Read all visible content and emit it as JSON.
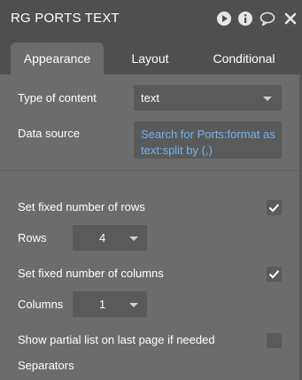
{
  "header": {
    "title": "RG PORTS TEXT",
    "icons": [
      "play-icon",
      "info-icon",
      "comment-icon",
      "close-icon"
    ]
  },
  "tabs": [
    {
      "label": "Appearance",
      "active": true
    },
    {
      "label": "Layout",
      "active": false
    },
    {
      "label": "Conditional",
      "active": false
    }
  ],
  "appearance": {
    "type_of_content": {
      "label": "Type of content",
      "value": "text"
    },
    "data_source": {
      "label": "Data source",
      "value": "Search for Ports:format as text:split by (,)"
    },
    "fixed_rows": {
      "label": "Set fixed number of rows",
      "checked": true
    },
    "rows": {
      "label": "Rows",
      "value": "4"
    },
    "fixed_columns": {
      "label": "Set fixed number of columns",
      "checked": true
    },
    "columns": {
      "label": "Columns",
      "value": "1"
    },
    "partial_list": {
      "label": "Show partial list on last page if needed",
      "checked": false
    },
    "separators": {
      "label": "Separators"
    }
  },
  "colors": {
    "header_bg": "#4f4f4f",
    "panel_bg": "#6c6c6c",
    "field_bg": "#5a5a5a",
    "dynamic_text": "#6fb5f5",
    "text": "#ffffff"
  }
}
